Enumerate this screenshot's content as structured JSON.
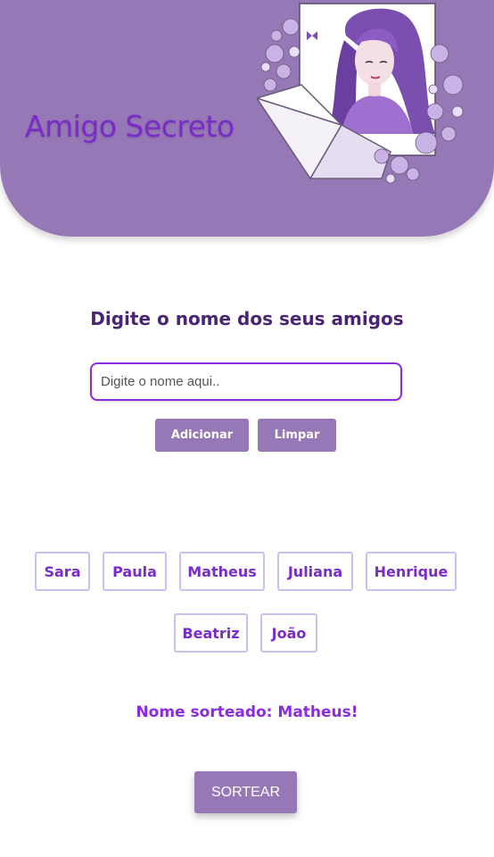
{
  "header": {
    "title": "Amigo Secreto"
  },
  "form": {
    "heading": "Digite o nome dos seus amigos",
    "input_placeholder": "Digite o nome aqui..",
    "input_value": "",
    "add_label": "Adicionar",
    "clear_label": "Limpar"
  },
  "friends": [
    "Sara",
    "Paula",
    "Matheus",
    "Juliana",
    "Henrique",
    "Beatriz",
    "João"
  ],
  "result": {
    "text": "Nome sorteado: Matheus!"
  },
  "draw": {
    "label": "SORTEAR"
  },
  "colors": {
    "primary": "#9678b6",
    "accent": "#8a2be2",
    "title": "#7a2cc8",
    "chip_border": "#c9c2f0"
  }
}
